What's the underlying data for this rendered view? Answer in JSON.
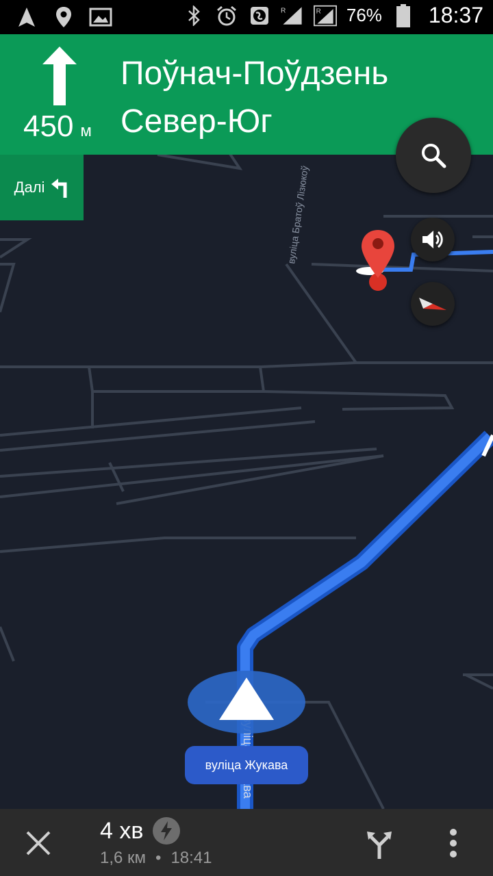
{
  "status_bar": {
    "battery": "76%",
    "time": "18:37",
    "icons": [
      "navigation-icon",
      "location-pin-icon",
      "image-icon",
      "bluetooth-icon",
      "alarm-icon",
      "globe-icon",
      "signal-r-icon",
      "signal-r-icon"
    ]
  },
  "banner": {
    "distance_value": "450",
    "distance_unit": "м",
    "street_line1": "Поўнач-Поўдзень",
    "street_line2": "Север-Юг",
    "color": "#0b9a57"
  },
  "next_turn": {
    "label": "Далі",
    "icon": "turn-left-icon"
  },
  "map": {
    "road_label_vertical": "вуліца Братоў Лізюкоў",
    "road_label_current_vertical": "вуліца Жукава",
    "route_color": "#3a7df0"
  },
  "current_street": {
    "label": "вуліца Жукава"
  },
  "eta": {
    "duration": "4 хв",
    "distance": "1,6 км",
    "separator": "•",
    "arrival_time": "18:41"
  }
}
